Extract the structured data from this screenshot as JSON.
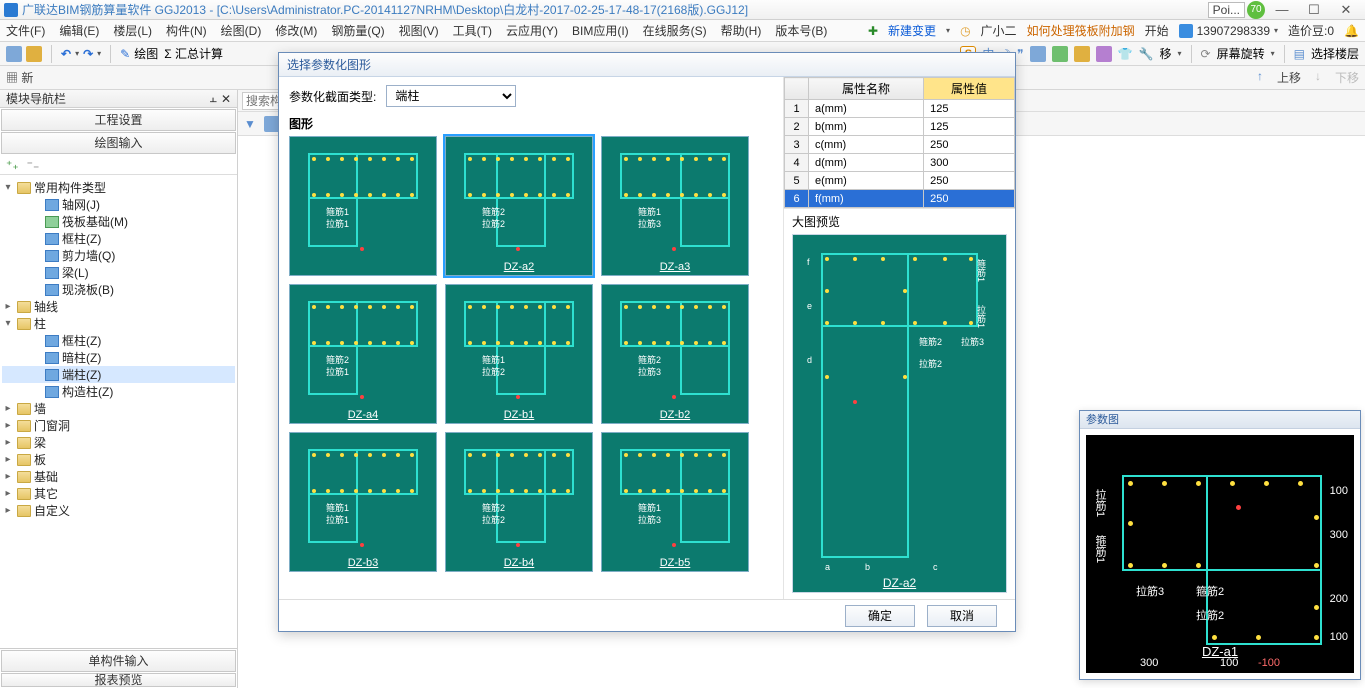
{
  "title_app": "广联达BIM钢筋算量软件 GGJ2013 - [C:\\Users\\Administrator.PC-20141127NRHM\\Desktop\\白龙村-2017-02-25-17-48-17(2168版).GGJ12]",
  "title_poi": "Poi...",
  "title_badge": "70",
  "menus": [
    "文件(F)",
    "编辑(E)",
    "楼层(L)",
    "构件(N)",
    "绘图(D)",
    "修改(M)",
    "钢筋量(Q)",
    "视图(V)",
    "工具(T)",
    "云应用(Y)",
    "BIM应用(I)",
    "在线服务(S)",
    "帮助(H)",
    "版本号(B)"
  ],
  "menu_right": {
    "new": "新建变更",
    "xiaoer": "广小二",
    "help": "如何处理筏板附加钢",
    "start": "开始",
    "user": "13907298339",
    "cost": "造价豆:0"
  },
  "tb2": {
    "draw": "绘图",
    "sum": "Σ 汇总计算"
  },
  "tb2_right": {
    "move": "移",
    "rotate": "屏幕旋转",
    "selfloor": "选择楼层"
  },
  "subbar": {
    "up": "上移",
    "down": "下移"
  },
  "left": {
    "nav": "模块导航栏",
    "proj": "工程设置",
    "draw": "绘图输入",
    "tree": {
      "c0": "常用构件类型",
      "c0_0": "轴网(J)",
      "c0_1": "筏板基础(M)",
      "c0_2": "框柱(Z)",
      "c0_3": "剪力墙(Q)",
      "c0_4": "梁(L)",
      "c0_5": "现浇板(B)",
      "c1": "轴线",
      "c2": "柱",
      "c2_0": "框柱(Z)",
      "c2_1": "暗柱(Z)",
      "c2_2": "端柱(Z)",
      "c2_3": "构造柱(Z)",
      "c3": "墙",
      "c4": "门窗洞",
      "c5": "梁",
      "c6": "板",
      "c7": "基础",
      "c8": "其它",
      "c9": "自定义"
    },
    "bottom1": "单构件输入",
    "bottom2": "报表预览"
  },
  "search_ph": "搜索构",
  "modal": {
    "title": "选择参数化图形",
    "type_label": "参数化截面类型:",
    "type_value": "端柱",
    "grid_label": "图形",
    "shapes": [
      "",
      "DZ-a2",
      "DZ-a3",
      "DZ-a4",
      "DZ-b1",
      "DZ-b2",
      "DZ-b3",
      "DZ-b4",
      "DZ-b5"
    ],
    "props_header": {
      "name": "属性名称",
      "val": "属性值"
    },
    "props": [
      {
        "i": "1",
        "n": "a(mm)",
        "v": "125"
      },
      {
        "i": "2",
        "n": "b(mm)",
        "v": "125"
      },
      {
        "i": "3",
        "n": "c(mm)",
        "v": "250"
      },
      {
        "i": "4",
        "n": "d(mm)",
        "v": "300"
      },
      {
        "i": "5",
        "n": "e(mm)",
        "v": "250"
      },
      {
        "i": "6",
        "n": "f(mm)",
        "v": "250"
      }
    ],
    "preview_label": "大图预览",
    "preview_cap": "DZ-a2",
    "preview_tags": {
      "g1": "箍筋2",
      "l3": "拉筋3",
      "l2": "拉筋2"
    },
    "ok": "确定",
    "cancel": "取消"
  },
  "rpanel": {
    "title": "参数图",
    "cap": "DZ-a1",
    "tags": {
      "lj1": "拉筋1",
      "gj1": "箍筋1",
      "lj3": "拉筋3",
      "gj2": "箍筋2",
      "lj2": "拉筋2"
    },
    "dims": {
      "d300a": "300",
      "d100a": "100",
      "d100b": "100",
      "d300b": "300",
      "d200": "200",
      "d100c": "100",
      "n100": "-100"
    }
  }
}
